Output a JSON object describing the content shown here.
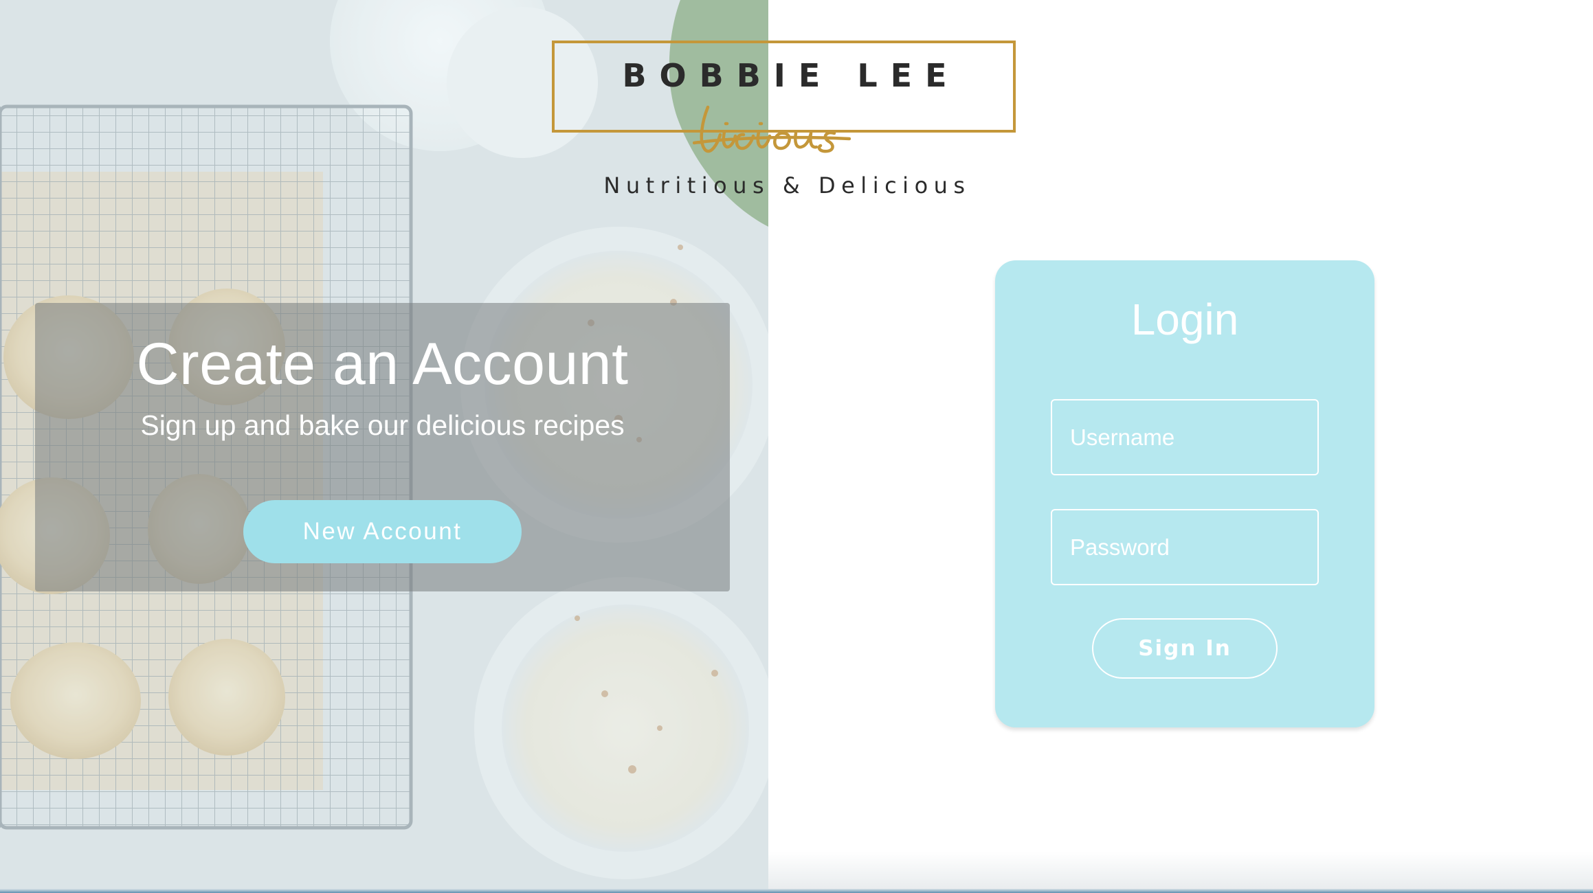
{
  "brand": {
    "name": "BOBBIE LEE",
    "script": "licious",
    "tagline": "Nutritious & Delicious",
    "gold_color": "#c4973a"
  },
  "signup": {
    "title": "Create an Account",
    "subtitle": "Sign up and bake our delicious recipes",
    "button_label": "New Account",
    "button_color": "#9fe0ea"
  },
  "login": {
    "title": "Login",
    "username": {
      "placeholder": "Username",
      "value": ""
    },
    "password": {
      "placeholder": "Password",
      "value": ""
    },
    "submit_label": "Sign In",
    "card_color": "#b6e8ef"
  }
}
